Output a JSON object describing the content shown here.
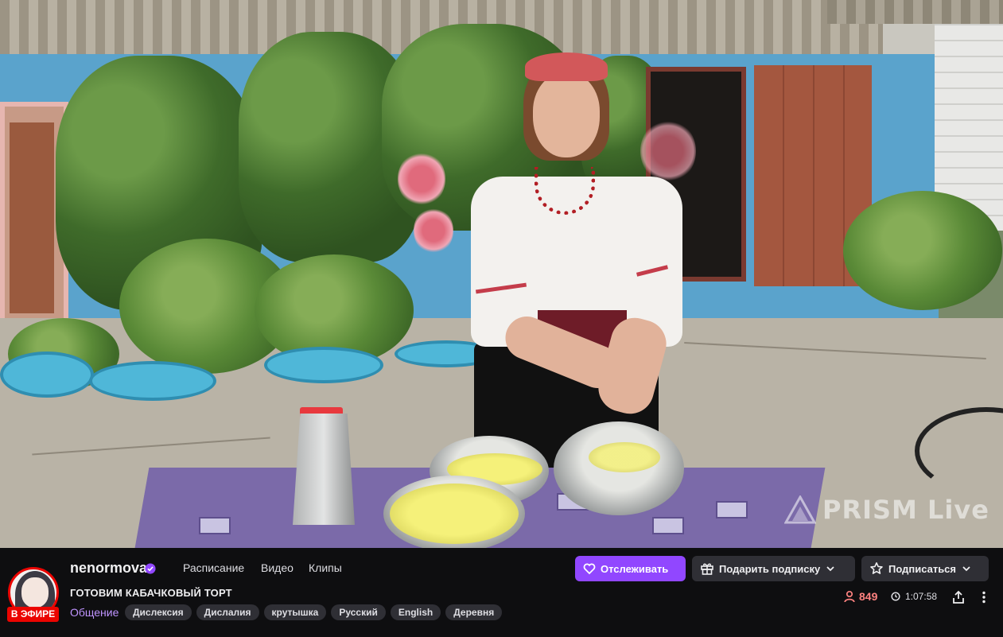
{
  "video": {
    "watermark": "PRISM Live"
  },
  "channel": {
    "name": "nenormova",
    "live_badge": "В ЭФИРЕ",
    "verified": true
  },
  "nav": {
    "schedule": "Расписание",
    "videos": "Видео",
    "clips": "Клипы"
  },
  "stream": {
    "title": "ГОТОВИМ КАБАЧКОВЫЙ ТОРТ",
    "category": "Общение",
    "tags": [
      "Дислексия",
      "Дислалия",
      "крутышка",
      "Русский",
      "English",
      "Деревня"
    ],
    "viewers": "849",
    "uptime": "1:07:58"
  },
  "actions": {
    "follow": "Отслеживать",
    "gift": "Подарить подписку",
    "subscribe": "Подписаться"
  },
  "colors": {
    "accent": "#9147ff",
    "live": "#eb0400",
    "viewers": "#ff8280",
    "category": "#bf94ff"
  }
}
